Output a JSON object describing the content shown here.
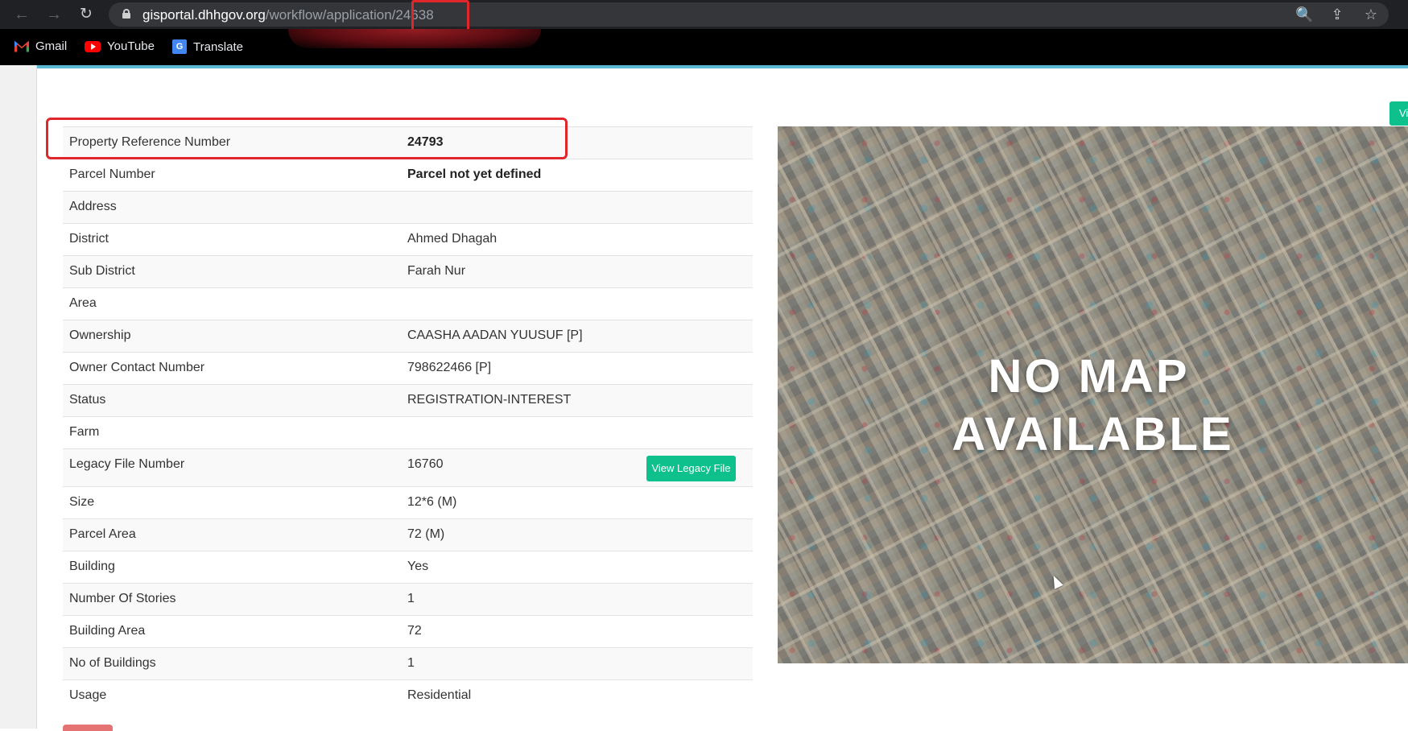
{
  "browser": {
    "url_host": "gisportal.dhhgov.org",
    "url_path": "/workflow/application/",
    "url_id": "24638",
    "back_icon": "←",
    "forward_icon": "→",
    "reload_icon": "↻",
    "zoom_icon": "🔍",
    "share_icon": "⇪",
    "star_icon": "☆"
  },
  "bookmarks": [
    {
      "label": "Gmail"
    },
    {
      "label": "YouTube"
    },
    {
      "label": "Translate"
    }
  ],
  "property": {
    "rows": [
      {
        "label": "Property Reference Number",
        "value": "24793",
        "bold": true
      },
      {
        "label": "Parcel Number",
        "value": "Parcel not yet defined",
        "bold": true
      },
      {
        "label": "Address",
        "value": ""
      },
      {
        "label": "District",
        "value": "Ahmed Dhagah"
      },
      {
        "label": "Sub District",
        "value": "Farah Nur"
      },
      {
        "label": "Area",
        "value": ""
      },
      {
        "label": "Ownership",
        "value": "CAASHA AADAN YUUSUF [P]"
      },
      {
        "label": "Owner Contact Number",
        "value": "798622466 [P]"
      },
      {
        "label": "Status",
        "value": "REGISTRATION-INTEREST"
      },
      {
        "label": "Farm",
        "value": ""
      },
      {
        "label": "Legacy File Number",
        "value": "16760"
      },
      {
        "label": "Size",
        "value": "12*6 (M)"
      },
      {
        "label": "Parcel Area",
        "value": "72 (M)"
      },
      {
        "label": "Building",
        "value": "Yes"
      },
      {
        "label": "Number Of Stories",
        "value": "1"
      },
      {
        "label": "Building Area",
        "value": "72"
      },
      {
        "label": "No of Buildings",
        "value": "1"
      },
      {
        "label": "Usage",
        "value": "Residential"
      }
    ],
    "legacy_button_label": "View Legacy File"
  },
  "map": {
    "line1": "NO MAP",
    "line2": "AVAILABLE"
  },
  "view_button_label": "Vi"
}
